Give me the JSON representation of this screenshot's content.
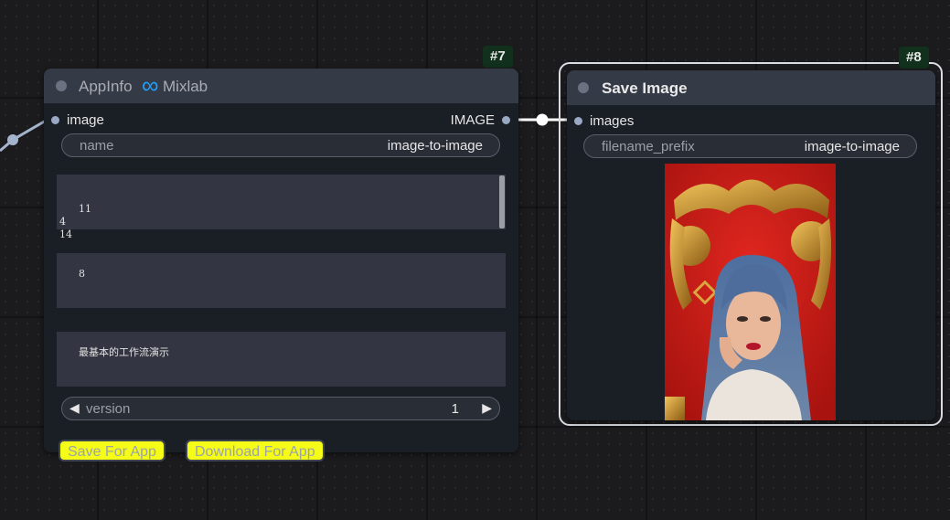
{
  "appinfo_node": {
    "badge": "#7",
    "title": "AppInfo",
    "brand_label": "Mixlab",
    "input_label": "image",
    "output_label": "IMAGE",
    "name_widget": {
      "label": "name",
      "value": "image-to-image"
    },
    "ids_text": "11\n4\n14",
    "output_ids_text": "8",
    "description_text": "最基本的工作流演示",
    "version_widget": {
      "label": "version",
      "value": "1"
    },
    "save_button": "Save For App",
    "download_button": "Download For App"
  },
  "save_image_node": {
    "badge": "#8",
    "title": "Save Image",
    "input_label": "images",
    "prefix_widget": {
      "label": "filename_prefix",
      "value": "image-to-image"
    }
  },
  "colors": {
    "canvas": "#1b1b1d",
    "node_body": "#1a1e25",
    "node_title": "#353a47",
    "badge": "#11311c",
    "button_yellow": "#f4fc18",
    "link_white": "#ffffff",
    "mixlab_blue": "#1ea0ff"
  }
}
